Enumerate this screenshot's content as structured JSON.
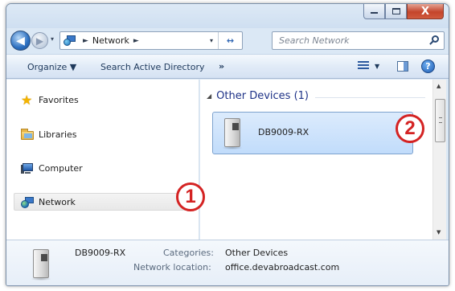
{
  "window": {
    "caption": {
      "minimize": "—",
      "maximize": "□",
      "close": "X"
    }
  },
  "address": {
    "back_glyph": "◀",
    "forward_glyph": "▶",
    "dropdown_glyph": "▾",
    "crumb_sep": "►",
    "crumbs": [
      "Network"
    ],
    "refresh_glyph": "↔"
  },
  "search": {
    "placeholder": "Search Network"
  },
  "toolbar": {
    "organize": "Organize ▼",
    "search_ad": "Search Active Directory",
    "more": "»",
    "views_dropdown": "▼",
    "help": "?"
  },
  "sidebar": {
    "items": [
      {
        "label": "Favorites",
        "icon": "star-icon"
      },
      {
        "label": "Libraries",
        "icon": "folder-icon"
      },
      {
        "label": "Computer",
        "icon": "computer-icon"
      },
      {
        "label": "Network",
        "icon": "network-icon",
        "selected": true
      }
    ]
  },
  "content": {
    "group_arrow": "◢",
    "group_title": "Other Devices (1)",
    "devices": [
      {
        "name": "DB9009-RX",
        "icon": "device-icon",
        "selected": true
      }
    ]
  },
  "scrollbar": {
    "up": "▲",
    "down": "▼"
  },
  "details": {
    "name": "DB9009-RX",
    "categories_label": "Categories:",
    "categories_value": "Other Devices",
    "location_label": "Network location:",
    "location_value": "office.devabroadcast.com"
  },
  "callouts": {
    "one": "1",
    "two": "2"
  },
  "colors": {
    "accent": "#1e3287",
    "callout": "#d42323",
    "selection": "#c1dcfb"
  }
}
